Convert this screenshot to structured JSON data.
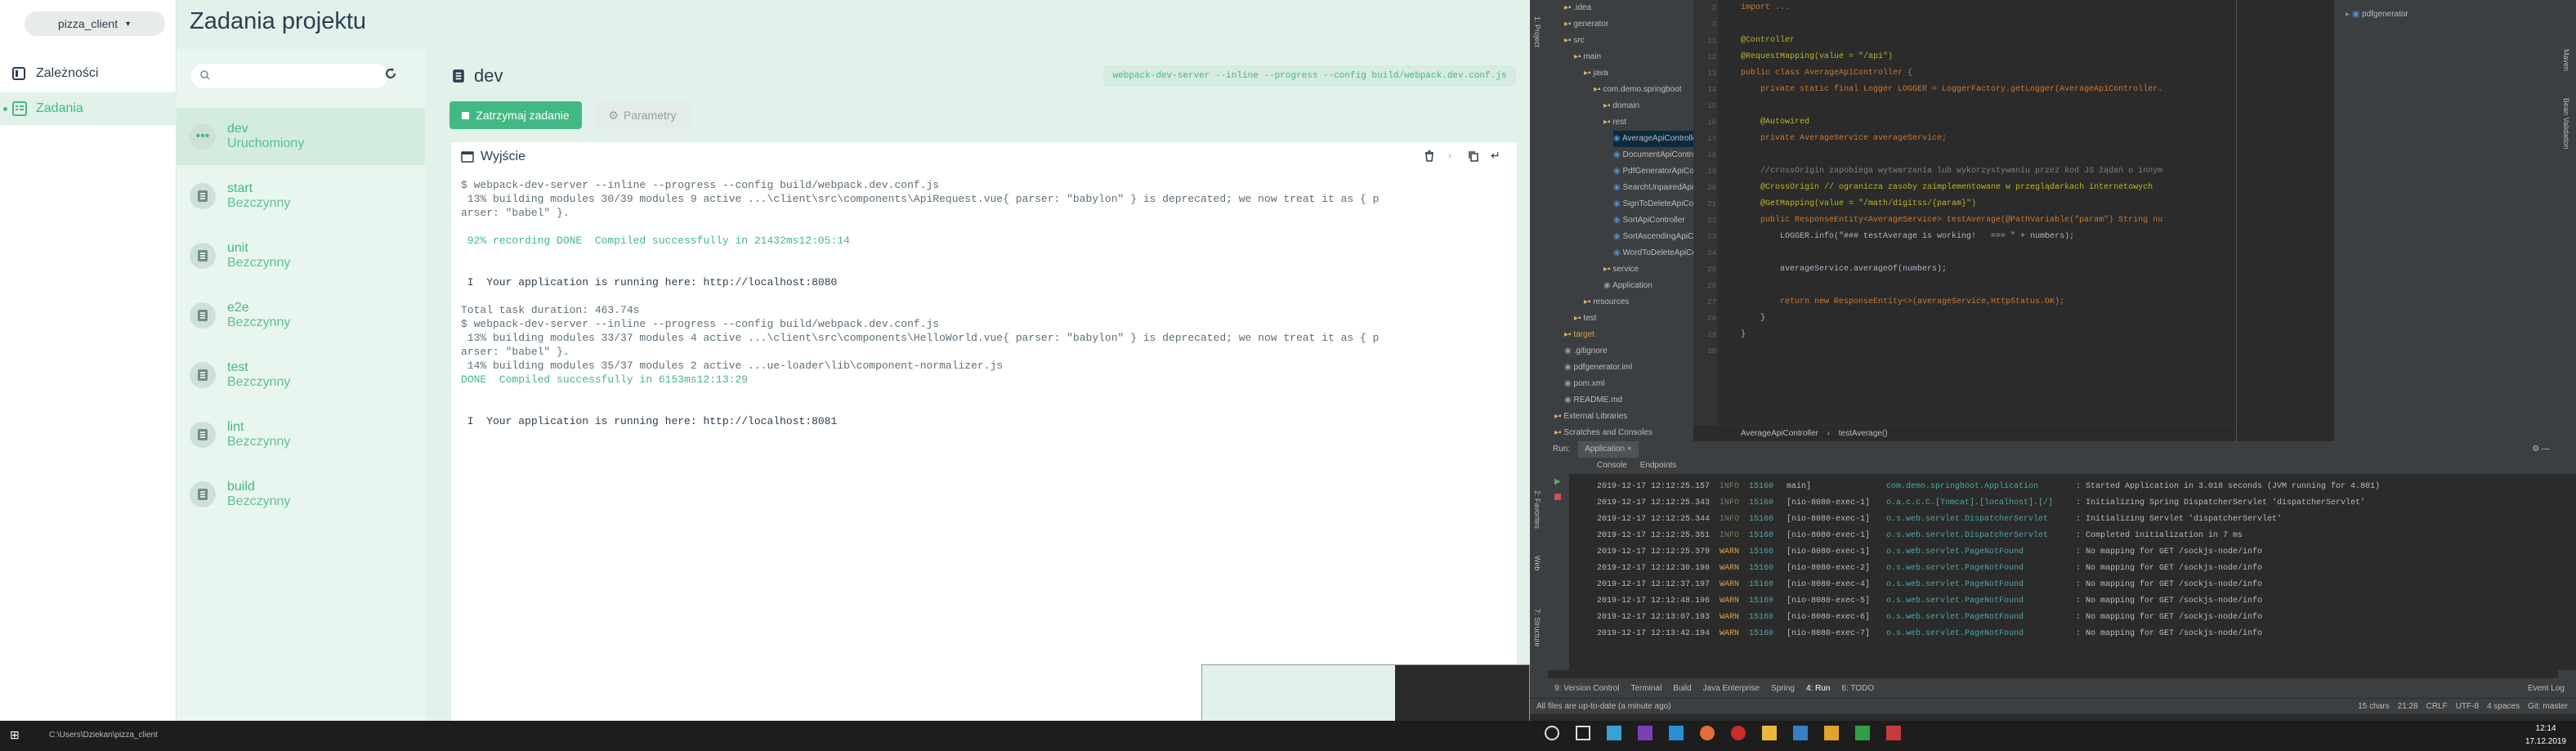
{
  "vue": {
    "project_picker": "pizza_client",
    "nav": [
      {
        "label": "Zależności"
      },
      {
        "label": "Zadania"
      }
    ],
    "title": "Zadania projektu",
    "search": {
      "placeholder": ""
    },
    "tasks": [
      {
        "name": "dev",
        "status": "Uruchomiony"
      },
      {
        "name": "start",
        "status": "Bezczynny"
      },
      {
        "name": "unit",
        "status": "Bezczynny"
      },
      {
        "name": "e2e",
        "status": "Bezczynny"
      },
      {
        "name": "test",
        "status": "Bezczynny"
      },
      {
        "name": "lint",
        "status": "Bezczynny"
      },
      {
        "name": "build",
        "status": "Bezczynny"
      }
    ],
    "detail": {
      "name": "dev",
      "command": "webpack-dev-server --inline --progress --config build/webpack.dev.conf.js",
      "stop_label": "Zatrzymaj zadanie",
      "params_label": "Parametry",
      "output_title": "Wyjście"
    },
    "terminal": [
      "$ webpack-dev-server --inline --progress --config build/webpack.dev.conf.js",
      " 13% building modules 30/39 modules 9 active ...\\client\\src\\components\\ApiRequest.vue{ parser: \"babylon\" } is deprecated; we now treat it as { p",
      "arser: \"babel\" }.",
      "",
      " 92% recording DONE  Compiled successfully in 21432ms12:05:14",
      "",
      "",
      " I  Your application is running here: http://localhost:8080",
      "",
      "Total task duration: 463.74s",
      "$ webpack-dev-server --inline --progress --config build/webpack.dev.conf.js",
      " 13% building modules 33/37 modules 4 active ...\\client\\src\\components\\HelloWorld.vue{ parser: \"babylon\" } is deprecated; we now treat it as { p",
      "arser: \"babel\" }.",
      " 14% building modules 35/37 modules 2 active ...ue-loader\\lib\\component-normalizer.js",
      "DONE  Compiled successfully in 6153ms12:13:29",
      "",
      "",
      " I  Your application is running here: http://localhost:8081"
    ]
  },
  "ide": {
    "project_tree": [
      {
        "label": ".idea",
        "depth": 1
      },
      {
        "label": "generator",
        "depth": 1
      },
      {
        "label": "src",
        "depth": 1
      },
      {
        "label": "main",
        "depth": 2
      },
      {
        "label": "java",
        "depth": 3
      },
      {
        "label": "com.demo.springboot",
        "depth": 4
      },
      {
        "label": "domain",
        "depth": 5
      },
      {
        "label": "rest",
        "depth": 5
      },
      {
        "label": "AverageApiController",
        "depth": 6
      },
      {
        "label": "DocumentApiController",
        "depth": 6
      },
      {
        "label": "PdfGeneratorApiController",
        "depth": 6
      },
      {
        "label": "SearchUnpairedApiController",
        "depth": 6
      },
      {
        "label": "SignToDeleteApiController",
        "depth": 6
      },
      {
        "label": "SortApiController",
        "depth": 6
      },
      {
        "label": "SortAscendingApiController",
        "depth": 6
      },
      {
        "label": "WordToDeleteApiController",
        "depth": 6
      },
      {
        "label": "service",
        "depth": 5
      },
      {
        "label": "Application",
        "depth": 5
      },
      {
        "label": "resources",
        "depth": 3
      },
      {
        "label": "test",
        "depth": 2
      },
      {
        "label": "target",
        "depth": 1
      },
      {
        "label": ".gitignore",
        "depth": 1
      },
      {
        "label": "pdfgenerator.iml",
        "depth": 1
      },
      {
        "label": "pom.xml",
        "depth": 1
      },
      {
        "label": "README.md",
        "depth": 1
      },
      {
        "label": "External Libraries",
        "depth": 0
      },
      {
        "label": "Scratches and Consoles",
        "depth": 0
      }
    ],
    "code_lines": [
      {
        "n": "2",
        "t": "import ..."
      },
      {
        "n": "3",
        "t": ""
      },
      {
        "n": "11",
        "t": "@Controller"
      },
      {
        "n": "12",
        "t": "@RequestMapping(value = \"/api\")"
      },
      {
        "n": "13",
        "t": "public class AverageApiController {"
      },
      {
        "n": "14",
        "t": "    private static final Logger LOGGER = LoggerFactory.getLogger(AverageApiController."
      },
      {
        "n": "15",
        "t": ""
      },
      {
        "n": "16",
        "t": "    @Autowired"
      },
      {
        "n": "17",
        "t": "    private AverageService averageService;"
      },
      {
        "n": "18",
        "t": ""
      },
      {
        "n": "19",
        "t": "    //crossOrigin zapobiega wytwarzania lub wykorzystywaniu przez kod JS żądań o innym"
      },
      {
        "n": "20",
        "t": "    @CrossOrigin // ogranicza zasoby zaimplementowane w przeglądarkach internetowych"
      },
      {
        "n": "21",
        "t": "    @GetMapping(value = \"/math/digitss/{param}\")"
      },
      {
        "n": "22",
        "t": "    public ResponseEntity<AverageService> testAverage(@PathVariable(\"param\") String nu"
      },
      {
        "n": "23",
        "t": "        LOGGER.info(\"### testAverage is working!   === \" + numbers);"
      },
      {
        "n": "24",
        "t": ""
      },
      {
        "n": "25",
        "t": "        averageService.averageOf(numbers);"
      },
      {
        "n": "26",
        "t": ""
      },
      {
        "n": "27",
        "t": "        return new ResponseEntity<>(averageService,HttpStatus.OK);"
      },
      {
        "n": "28",
        "t": "    }"
      },
      {
        "n": "29",
        "t": "}"
      },
      {
        "n": "30",
        "t": ""
      }
    ],
    "breadcrumb": [
      "AverageApiController",
      "testAverage()"
    ],
    "structure_root": "pdfgenerator",
    "run_label": "Run:",
    "run_tab": "Application",
    "run_subtabs": [
      "Console",
      "Endpoints"
    ],
    "logs": [
      {
        "ts": "2019-12-17 12:12:25.157",
        "lvl": "INFO",
        "pid": "15160",
        "th": "main]",
        "cls": "com.demo.springboot.Application",
        "msg": ": Started Application in 3.018 seconds (JVM running for 4.801)"
      },
      {
        "ts": "2019-12-17 12:12:25.343",
        "lvl": "INFO",
        "pid": "15160",
        "th": "[nio-8080-exec-1]",
        "cls": "o.a.c.c.C.[Tomcat].[localhost].[/]",
        "msg": ": Initializing Spring DispatcherServlet 'dispatcherServlet'"
      },
      {
        "ts": "2019-12-17 12:12:25.344",
        "lvl": "INFO",
        "pid": "15160",
        "th": "[nio-8080-exec-1]",
        "cls": "o.s.web.servlet.DispatcherServlet",
        "msg": ": Initializing Servlet 'dispatcherServlet'"
      },
      {
        "ts": "2019-12-17 12:12:25.351",
        "lvl": "INFO",
        "pid": "15160",
        "th": "[nio-8080-exec-1]",
        "cls": "o.s.web.servlet.DispatcherServlet",
        "msg": ": Completed initialization in 7 ms"
      },
      {
        "ts": "2019-12-17 12:12:25.379",
        "lvl": "WARN",
        "pid": "15160",
        "th": "[nio-8080-exec-1]",
        "cls": "o.s.web.servlet.PageNotFound",
        "msg": ": No mapping for GET /sockjs-node/info"
      },
      {
        "ts": "2019-12-17 12:12:30.198",
        "lvl": "WARN",
        "pid": "15160",
        "th": "[nio-8080-exec-2]",
        "cls": "o.s.web.servlet.PageNotFound",
        "msg": ": No mapping for GET /sockjs-node/info"
      },
      {
        "ts": "2019-12-17 12:12:37.197",
        "lvl": "WARN",
        "pid": "15160",
        "th": "[nio-8080-exec-4]",
        "cls": "o.s.web.servlet.PageNotFound",
        "msg": ": No mapping for GET /sockjs-node/info"
      },
      {
        "ts": "2019-12-17 12:12:48.196",
        "lvl": "WARN",
        "pid": "15160",
        "th": "[nio-8080-exec-5]",
        "cls": "o.s.web.servlet.PageNotFound",
        "msg": ": No mapping for GET /sockjs-node/info"
      },
      {
        "ts": "2019-12-17 12:13:07.193",
        "lvl": "WARN",
        "pid": "15160",
        "th": "[nio-8080-exec-6]",
        "cls": "o.s.web.servlet.PageNotFound",
        "msg": ": No mapping for GET /sockjs-node/info"
      },
      {
        "ts": "2019-12-17 12:13:42.194",
        "lvl": "WARN",
        "pid": "15160",
        "th": "[nio-8080-exec-7]",
        "cls": "o.s.web.servlet.PageNotFound",
        "msg": ": No mapping for GET /sockjs-node/info"
      }
    ],
    "bottom_tabs": [
      "9: Version Control",
      "Terminal",
      "Build",
      "Java Enterprise",
      "Spring",
      "4: Run",
      "6: TODO"
    ],
    "event_log": "Event Log",
    "status_left": "All files are up-to-date (a minute ago)",
    "status_right": [
      "15 chars",
      "21:28",
      "CRLF",
      "UTF-8",
      "4 spaces",
      "Git: master"
    ],
    "side_tabs_left": [
      "1: Project",
      "7: Structure",
      "2: Favorites",
      "Web"
    ],
    "side_tabs_right": [
      "Maven",
      "Bean Validation"
    ]
  },
  "taskbar": {
    "time": "12:14",
    "date": "17.12.2019",
    "left_text": "C:\\Users\\Dziekan\\pizza_client"
  },
  "colors": {
    "accent": "#42b983",
    "ide_bg": "#2b2b2b"
  }
}
